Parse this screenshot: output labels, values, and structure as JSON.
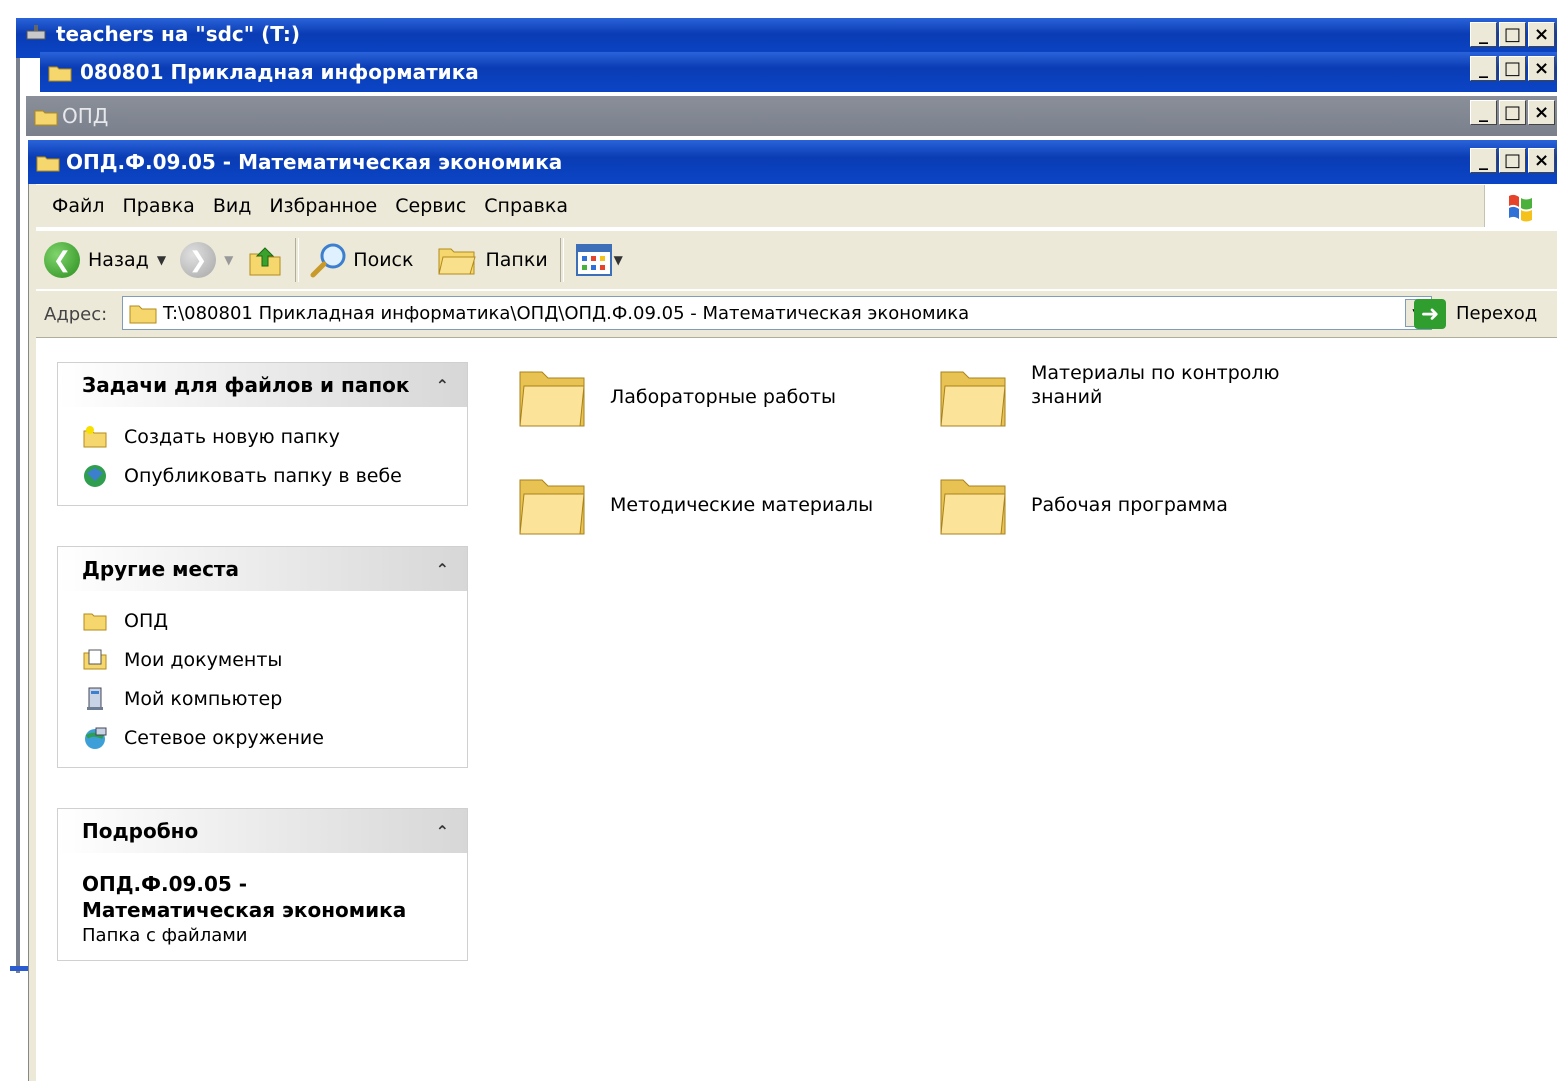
{
  "windows": {
    "back1_title": "teachers на \"sdc\" (T:)",
    "back2_title": "080801 Прикладная информатика",
    "back3_title": "ОПД",
    "front_title": "ОПД.Ф.09.05 - Математическая экономика",
    "min_glyph": "_",
    "max_glyph": "□",
    "close_glyph": "×"
  },
  "menu": {
    "file": "Файл",
    "edit": "Правка",
    "view": "Вид",
    "favorites": "Избранное",
    "tools": "Сервис",
    "help": "Справка"
  },
  "toolbar": {
    "back_label": "Назад",
    "search_label": "Поиск",
    "folders_label": "Папки"
  },
  "address": {
    "label": "Адрес:",
    "path": "T:\\080801 Прикладная информатика\\ОПД\\ОПД.Ф.09.05 - Математическая экономика",
    "go_label": "Переход"
  },
  "tasks_panel": {
    "title": "Задачи для файлов и папок",
    "items": [
      "Создать новую папку",
      "Опубликовать папку в вебе"
    ]
  },
  "places_panel": {
    "title": "Другие места",
    "items": [
      "ОПД",
      "Мои документы",
      "Мой компьютер",
      "Сетевое окружение"
    ]
  },
  "details_panel": {
    "title": "Подробно",
    "name": "ОПД.Ф.09.05 - Математическая экономика",
    "type": "Папка с файлами"
  },
  "folders": [
    {
      "name": "Лабораторные работы"
    },
    {
      "name": "Материалы по контролю знаний"
    },
    {
      "name": "Методические материалы"
    },
    {
      "name": "Рабочая программа"
    }
  ],
  "colors": {
    "titlebar_active": "#0a3cb4",
    "titlebar_inactive": "#7a808c",
    "chrome": "#ece9d8",
    "folder": "#f5d76e"
  }
}
